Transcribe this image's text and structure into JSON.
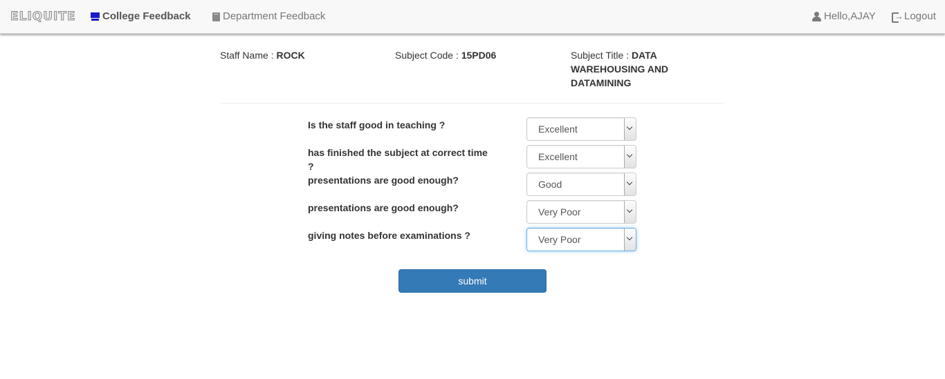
{
  "navbar": {
    "brand": "ELIQUITE",
    "links": [
      {
        "label": "College Feedback",
        "icon": "monitor-icon",
        "active": true
      },
      {
        "label": "Department Feedback",
        "icon": "book-icon",
        "active": false
      }
    ],
    "user_greeting": "Hello,AJAY",
    "logout_label": "Logout"
  },
  "subject_info": {
    "staff_name_label": "Staff Name :",
    "staff_name": "ROCK",
    "subject_code_label": "Subject Code :",
    "subject_code": "15PD06",
    "subject_title_label": "Subject Title :",
    "subject_title_line1": "DATA",
    "subject_title_line2": "WAREHOUSING AND",
    "subject_title_line3": "DATAMINING"
  },
  "questions": [
    {
      "line1": "Is the staff good in teaching ?",
      "line2": "",
      "answer": "Excellent"
    },
    {
      "line1": "has finished the subject at correct time",
      "line2": "?",
      "answer": "Excellent"
    },
    {
      "line1": "presentations are good enough?",
      "line2": "",
      "answer": "Good"
    },
    {
      "line1": "presentations are good enough?",
      "line2": "",
      "answer": "Very Poor"
    },
    {
      "line1": "giving notes before examinations ?",
      "line2": "",
      "answer": "Very Poor"
    }
  ],
  "submit_label": "submit",
  "colors": {
    "primary": "#337ab7",
    "focus": "#66afe9",
    "nav_background": "#f8f8f8"
  }
}
